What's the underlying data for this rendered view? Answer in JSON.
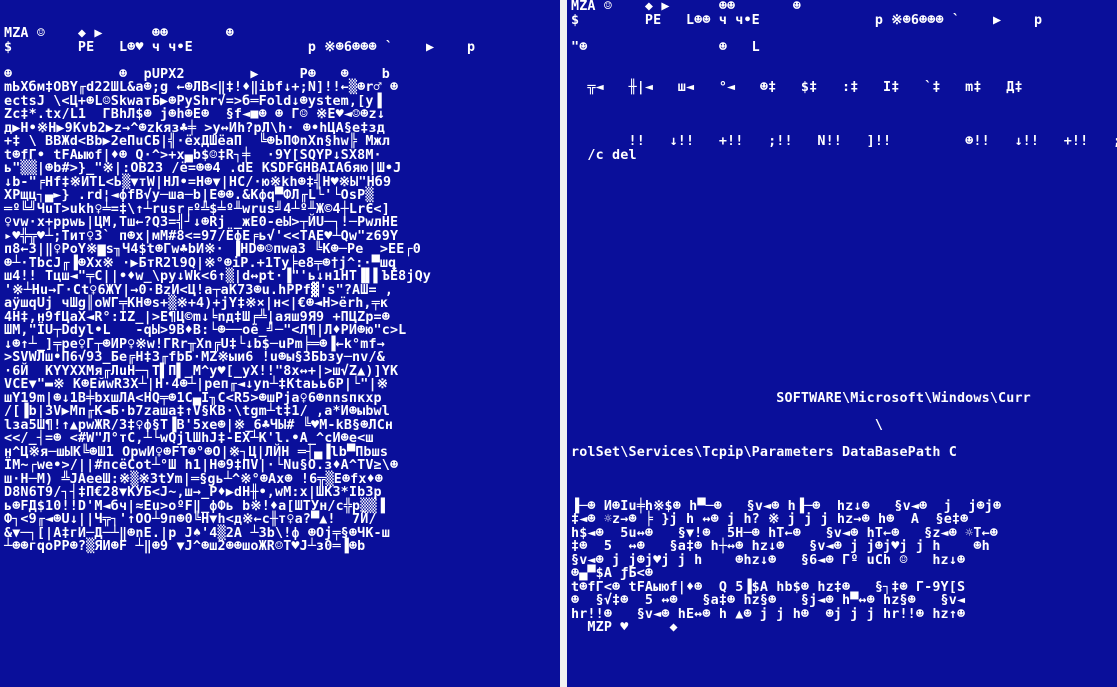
{
  "left_pane": {
    "lines": [
      "MZA ☺    ◆ ▶      ☻☻       ☻",
      "$        PE   L☻♥ ч ч•E              р ※☻6☻☻☻ `    ▶    р",
      "",
      "☻             ☻  рUPX2        ▶     P☻   ☻    b",
      "mЬXбм‡OBY╓d22ШL&a☻;g ←☻ЛB<‖‡!♦‖ibf↓+;N]!!←▒☻r♂ ☻",
      "ectsJ \\<Ц+☻L☺SkwaтБ▶☻PyShr√=>б═Fold↓☻ystem,[y▐",
      "Zc‡*.tx/L1  ГBhЛ$☻ j☻h☻E☻  §f◄■☻ ☻ Г☺ ※E♥◄☺☻z↓",
      "д▶H•※H▶9Kvb2▶z→^☻zkяз♣╪ >y↔Иh?рЛ\\h· ☻•hЦA§e‡зд",
      "+‡ \\ BBЖd<Bb▶2eПuCБ|╣·ёxДШёаП  ╚☻ЬПФnXn§hw╠ Мжл",
      "t☻fГ• tFAыюf|♦☻ Q·^>+x▄b$☺‡R┐╪  ·9Y[SQYP↓SX8M·",
      "ь\"▒▒|☻b#>}_\"※|:OB23 /ё=☻☻4 .dE KSDFGHBAIAбяю|Ш•J",
      "↓b-\"╒Hf‡※ИTL<Ь▒▼тW|НЛ•=H☻▼|HC/·ю※kh☻‡╣Н♥※Ы\"Нб9",
      "XPщц┐▄►} .rd¦◄фfB√у─ша─b|E☻☻.&Кфq▀ФЛ╓L└'└OsP▒",
      "═º╚╝ЧuТ>ukh♀╧=‡\\↑┴rusr╒º╩$╧º╨wrus╝4┴º╨Ж©4┼LrЄ<]",
      "♀vw·x+ррwь|ЦМ,Тш←?Q3=╣┘↓☻Rj _жE0-eЫ>┬ЙU─┐!─РwлHE",
      "▸♥╬╦♥┴;Тит♀3` п☻x|мМ#8<=97/ЁфЕ╒ь√'<<ТAE♥┴Qw\"z69Y",
      "п8←3|‖♀PoY※▆s╖Ч4$t☻Гw♣bИ※· ▐HD☻☺пwa3 ╚K☻─Pe  >EE┌0",
      "☻┴·ТbcJ╓▐☻Xх※ ·▶БтR2l9Q|※°☻iP.+1Ту╞e8╤☻†j^:·▀шq",
      "ш4!! Тцш◄\"╤C||•♦w_\\ру↓Wk<6↑▒|d↔рt·▐\"'ь↓н1НТ▐▌▌ЪЁ8jQу",
      "'※┴Hu→Г·Ct♀6ЖY|→0·BzИ<Ц!а┬aK73☻u.hPPf▓'s\"?AШ= ,",
      "aÿшqUj чШg║oWГ╤КН☻s+▒※+4)+jY‡※×|н<|€☻◄Н>ёrh,╤к",
      "4Н‡,н9fЦaX◄R°:IZ_|>E¶Ц©m↓╘nд‡Ш╒╩|аяш9Я9 +ПЦZр=☻",
      "ШМ,\"ÏU┬Ddуl•L   -qЫ>9B♦B:└☻──oё_╝─\"<Л¶|Л♦РИ☻ю\"c>L",
      "↓☻↑┴_]╤рe♀Г┬☻ИP♀※w!ГRr╥Xn╔U‡└↓b$─uPm╞═☻▐←k°mf→",
      ">SVWЛш•П6√93_Бe╔Н‡3╓fbБ·MZ※ыи6 !u☻ы§3Бbзу─nv/&",
      "·6Й  KYYXXMя╓ЛuH─┐Т▌П▌_M^у♥[_yX!!\"8x↔+|>ш√Z▲)]YK",
      "VCE▼\"▬※ К☻EйwR3X┴|Н·4☻┴|реп╓◄↓уn┴‡Ktaьь6P|└\"|※",
      "шY19m|☻↓1B╪bхшЛA<HQ╤☻1C▄I╖C<R5>☻шPjа♀6☻nnsпкхр",
      "/[▐b|3V▶Мп╓К◄Б·b7zаша‡↑V§КВ·\\tgm┴t‡1/ ,а*И☻ыbwl",
      "lзa5Ш¶!↑▲рwЖR/3‡♀ф§Т▐B'5xe☻|※_6♣ЧЫ# ╚♥М-kB§☻ЛCн",
      "<</_┤=☻ <#W\"Л°тС,┴└wQjlШhJ‡-EX┴K'l.•А_^cИ☻e<ш",
      "н^Ц※я─шЫК╚☻Ш1 OрwИ♀☻FT☻°☻O|※┐Ц|ЛЙH ═┤▄▐lb▀Пbшs",
      "ÏM~┌we•>/||#пcёCot┴°Ш h1|Н☻9‡ПV|·└Nu§O.з♦A^TV≥\\☻",
      "ш·H─M) ╩JAeeШ:※▒※3tУm|═§gь┴^※°☻Ax☻ !6╦▒Е☻fx♦☻",
      "D8N6T9/┐┤‡П€28▼КУБ<J~,ш→_Р♦▶dH╫•,wМ:x|ШКЗ*Ib3р",
      "ь☻FД$10!!D'М◄бч|≈Eu>оºF‖_фФь b※!♦a[ШТУн/c╬р▒▒▐",
      "Ф┐<9╓◄☻U↓||Ч╦┐'↑OO┴9п☻0╚Н▼h<д※←c╫т♀a?▀▲!  7Й/",
      "&▼─┐[|A‡гИ─Д─┴‖☻nE.|р J♠'4▒2A ┴3b\\!ф ☻Oj╤§☻ЧК-ш",
      "┴☻☻гqoPP☻?▒ЯИ☻F ┴‖☻9 ▼J^☻ш2☻☻шоЖR☺Т♥J┴з0═▐☻b"
    ]
  },
  "right_pane": {
    "top_lines": [
      "MZA ☺    ◆ ▶      ☻☻       ☻",
      "$        PE   L☻☻ ч ч•E              р ※☻6☻☻☻ `    ▶    р",
      "",
      "\"☻                ☻   L",
      "",
      "",
      "  ╦◄   ╫|◄   ш◄   °◄   ☻‡   $‡   :‡   I‡   `‡   m‡   Д‡",
      "",
      "",
      "",
      "       !!   ↓!!   +!!   ;!!   N!!   ]!!         ☻!!   ↓!!   +!!   ;!!",
      "  /c del"
    ],
    "middle_lines": [
      {
        "text": "                         SOFTWARE\\Microsoft\\Windows\\Curr",
        "line_index": 29
      },
      {
        "text": "                                     \\",
        "line_index": 31
      },
      {
        "text": "rolSet\\Services\\Tcpip\\Parameters DataBasePath C",
        "line_index": 33
      }
    ],
    "bottom_start_index": 37,
    "bottom_lines": [
      "▐─☻ И☻Iu╪h※$☻ h▀─☻   §v◄☻ h▐─☻  hz↓☻   §v◄☻  j  j☻j☻",
      "‡◄☻ ☼z→☻ ╞ }j h ↔☻ j h? ※ j j j hz→☻ h☻  A  §e‡☻",
      "h$◄☻  5u↔☻   §▼!☻  5Н─☻ hТ←☻   §v◄☻ hТ←☻   §z◄☻ ☼Т←☻",
      "‡☻  5  ↔☻   §a‡☻ h┼↔☻ hz↓☻   §v◄☻ j j☻j♥j j h    ☻h",
      "§v◄☻ j j☻j♥j j h    ☻hz↓☻   §6◄☻ Гº uCh ☺   hz↓☻",
      "☻▄▀$A ƒБ<☻",
      "t☻fГ<☻ tFAыюf|♦☻  Q 5▐$A hb$☻ hz‡☻   §┐‡☻ Г-9Y[S",
      "☻  §√‡☻  5 ↔☻   §a‡☻ hz§☻   §j◄☻ h▀↔☻ hz§☻   §v◄",
      "hr!!☻   §v◄☻ hE↔☻ h ▲☻ j j h☻  ☻j j j hr!!☻ hz↑☻",
      "  MZP ♥     ◆"
    ]
  }
}
